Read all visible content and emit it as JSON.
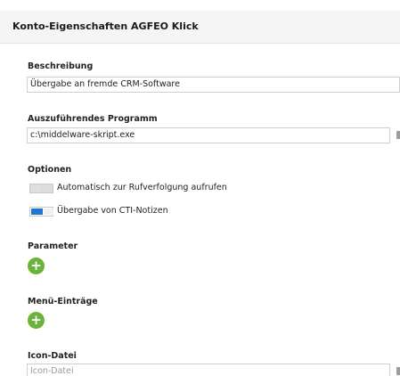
{
  "header": {
    "title": "Konto-Eigenschaften AGFEO Klick"
  },
  "beschreibung": {
    "label": "Beschreibung",
    "value": "Übergabe an fremde CRM-Software"
  },
  "programm": {
    "label": "Auszuführendes Programm",
    "value": "c:\\middelware-skript.exe"
  },
  "optionen": {
    "label": "Optionen",
    "items": [
      {
        "label": "Automatisch zur Rufverfolgung aufrufen",
        "enabled": false
      },
      {
        "label": "Übergabe von CTI-Notizen",
        "enabled": true
      }
    ]
  },
  "parameter": {
    "label": "Parameter",
    "add_symbol": "+"
  },
  "menu_eintraege": {
    "label": "Menü-Einträge",
    "add_symbol": "+"
  },
  "icon_datei": {
    "label": "Icon-Datei",
    "placeholder": "Icon-Datei"
  },
  "colors": {
    "accent": "#1f77d0",
    "add_button": "#6bb33c"
  }
}
